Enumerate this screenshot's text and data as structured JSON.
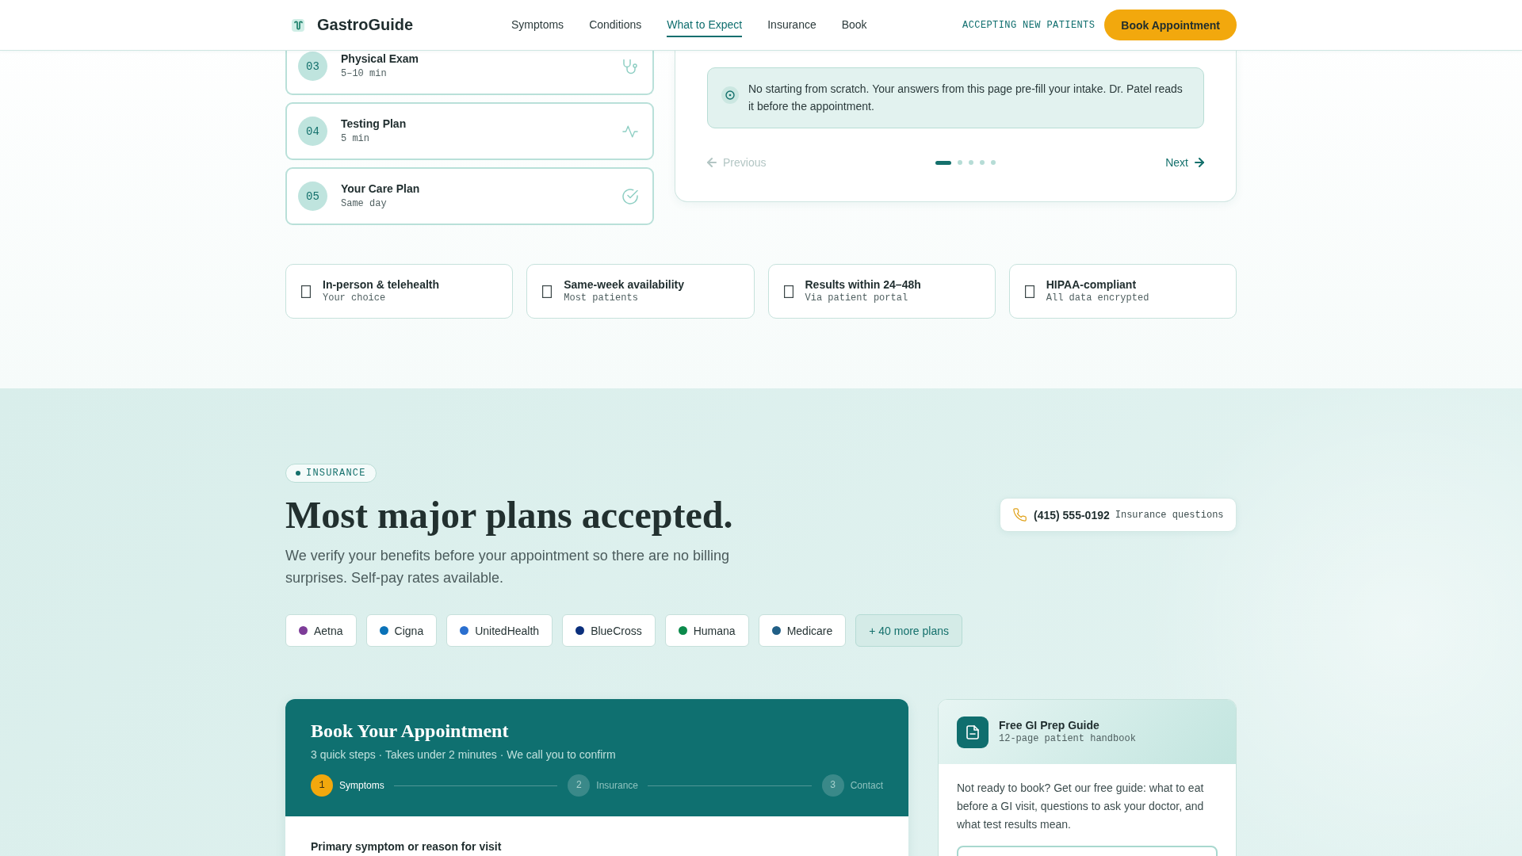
{
  "header": {
    "brand": "GastroGuide",
    "nav": [
      {
        "label": "Symptoms",
        "selected": false
      },
      {
        "label": "Conditions",
        "selected": false
      },
      {
        "label": "What to Expect",
        "selected": true
      },
      {
        "label": "Insurance",
        "selected": false
      },
      {
        "label": "Book",
        "selected": false
      }
    ],
    "status": "ACCEPTING NEW PATIENTS",
    "button": "Book Appointment"
  },
  "visit_steps": [
    {
      "number": "03",
      "title": "Physical Exam",
      "duration": "5–10 min"
    },
    {
      "number": "04",
      "title": "Testing Plan",
      "duration": "5 min"
    },
    {
      "number": "05",
      "title": "Your Care Plan",
      "duration": "Same day"
    }
  ],
  "step_detail": {
    "note": "No starting from scratch. Your answers from this page pre-fill your intake. Dr. Patel reads it before the appointment.",
    "previous": {
      "label": "Previous",
      "disabled": true
    },
    "pages": [
      {
        "selected": true
      },
      {
        "selected": false
      },
      {
        "selected": false
      },
      {
        "selected": false
      },
      {
        "selected": false
      }
    ],
    "next": {
      "label": "Next",
      "disabled": false
    }
  },
  "features": [
    {
      "title": "In-person & telehealth",
      "subtitle": "Your choice"
    },
    {
      "title": "Same-week availability",
      "subtitle": "Most patients"
    },
    {
      "title": "Results within 24–48h",
      "subtitle": "Via patient portal"
    },
    {
      "title": "HIPAA-compliant",
      "subtitle": "All data encrypted"
    }
  ],
  "insurance": {
    "tag": "INSURANCE",
    "heading": "Most major plans accepted.",
    "description": "We verify your benefits before your appointment so there are no billing surprises. Self-pay rates available.",
    "phone": {
      "number": "(415) 555-0192",
      "label": "Insurance questions"
    },
    "plans": [
      {
        "name": "Aetna",
        "color": "#7d3c98"
      },
      {
        "name": "Cigna",
        "color": "#0a72b8"
      },
      {
        "name": "UnitedHealth",
        "color": "#2a6fcf"
      },
      {
        "name": "BlueCross",
        "color": "#0b2f7c"
      },
      {
        "name": "Humana",
        "color": "#0b8a4b"
      },
      {
        "name": "Medicare",
        "color": "#215f86"
      }
    ],
    "more_plans": "+ 40 more plans"
  },
  "booking": {
    "title": "Book Your Appointment",
    "subtitle": "3 quick steps · Takes under 2 minutes · We call you to confirm",
    "steps": [
      {
        "number": "1",
        "label": "Symptoms",
        "selected": true
      },
      {
        "number": "2",
        "label": "Insurance",
        "selected": false
      },
      {
        "number": "3",
        "label": "Contact",
        "selected": false
      }
    ],
    "field_label": "Primary symptom or reason for visit"
  },
  "guide": {
    "title": "Free GI Prep Guide",
    "subtitle": "12-page patient handbook",
    "description": "Not ready to book? Get our free guide: what to eat before a GI visit, questions to ask your doctor, and what test results mean."
  }
}
